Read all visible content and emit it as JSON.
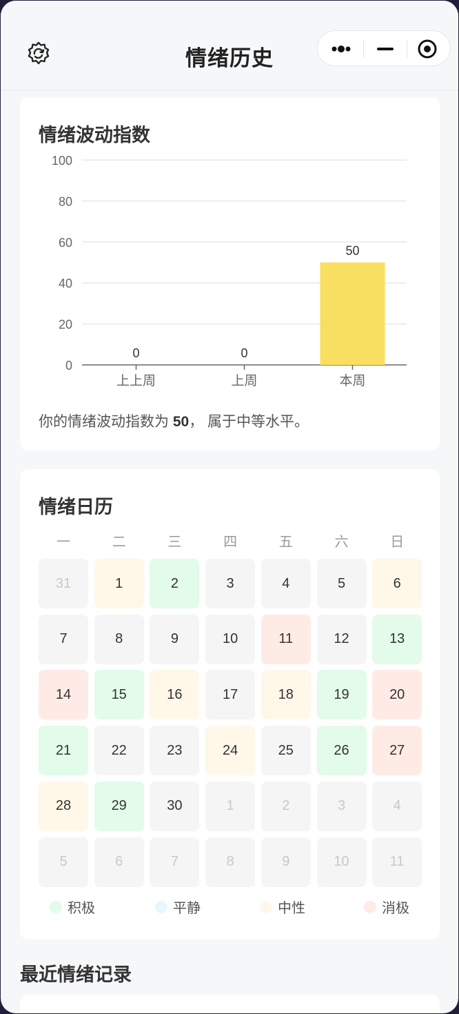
{
  "navbar": {
    "title": "情绪历史",
    "left_icon": "settings-gear-icon",
    "capsule": {
      "more_icon": "more-dots-icon",
      "minimize_icon": "minimize-icon",
      "close_icon": "target-close-icon"
    }
  },
  "fluctuation": {
    "title": "情绪波动指数",
    "summary_prefix": "你的情绪波动指数为 ",
    "summary_value": "50",
    "summary_suffix": "， 属于中等水平。"
  },
  "chart_data": {
    "type": "bar",
    "categories": [
      "上上周",
      "上周",
      "本周"
    ],
    "values": [
      0,
      0,
      50
    ],
    "data_labels": [
      "0",
      "0",
      "50"
    ],
    "ylim": [
      0,
      100
    ],
    "yticks": [
      0,
      20,
      40,
      60,
      80,
      100
    ],
    "grid": true,
    "bar_color": "#f8df5f"
  },
  "calendar": {
    "title": "情绪日历",
    "weekdays": [
      "一",
      "二",
      "三",
      "四",
      "五",
      "六",
      "日"
    ],
    "days": [
      {
        "n": "31",
        "mood": "none",
        "other": true
      },
      {
        "n": "1",
        "mood": "neutral",
        "other": false
      },
      {
        "n": "2",
        "mood": "positive",
        "other": false
      },
      {
        "n": "3",
        "mood": "none",
        "other": false
      },
      {
        "n": "4",
        "mood": "none",
        "other": false
      },
      {
        "n": "5",
        "mood": "none",
        "other": false
      },
      {
        "n": "6",
        "mood": "neutral",
        "other": false
      },
      {
        "n": "7",
        "mood": "none",
        "other": false
      },
      {
        "n": "8",
        "mood": "none",
        "other": false
      },
      {
        "n": "9",
        "mood": "none",
        "other": false
      },
      {
        "n": "10",
        "mood": "none",
        "other": false
      },
      {
        "n": "11",
        "mood": "negative",
        "other": false
      },
      {
        "n": "12",
        "mood": "none",
        "other": false
      },
      {
        "n": "13",
        "mood": "positive",
        "other": false
      },
      {
        "n": "14",
        "mood": "negative",
        "other": false
      },
      {
        "n": "15",
        "mood": "positive",
        "other": false
      },
      {
        "n": "16",
        "mood": "neutral",
        "other": false
      },
      {
        "n": "17",
        "mood": "none",
        "other": false
      },
      {
        "n": "18",
        "mood": "neutral",
        "other": false
      },
      {
        "n": "19",
        "mood": "positive",
        "other": false
      },
      {
        "n": "20",
        "mood": "negative",
        "other": false
      },
      {
        "n": "21",
        "mood": "positive",
        "other": false
      },
      {
        "n": "22",
        "mood": "none",
        "other": false
      },
      {
        "n": "23",
        "mood": "none",
        "other": false
      },
      {
        "n": "24",
        "mood": "neutral",
        "other": false
      },
      {
        "n": "25",
        "mood": "none",
        "other": false
      },
      {
        "n": "26",
        "mood": "positive",
        "other": false
      },
      {
        "n": "27",
        "mood": "negative",
        "other": false
      },
      {
        "n": "28",
        "mood": "neutral",
        "other": false
      },
      {
        "n": "29",
        "mood": "positive",
        "other": false
      },
      {
        "n": "30",
        "mood": "none",
        "other": false
      },
      {
        "n": "1",
        "mood": "none",
        "other": true
      },
      {
        "n": "2",
        "mood": "none",
        "other": true
      },
      {
        "n": "3",
        "mood": "none",
        "other": true
      },
      {
        "n": "4",
        "mood": "none",
        "other": true
      },
      {
        "n": "5",
        "mood": "none",
        "other": true
      },
      {
        "n": "6",
        "mood": "none",
        "other": true
      },
      {
        "n": "7",
        "mood": "none",
        "other": true
      },
      {
        "n": "8",
        "mood": "none",
        "other": true
      },
      {
        "n": "9",
        "mood": "none",
        "other": true
      },
      {
        "n": "10",
        "mood": "none",
        "other": true
      },
      {
        "n": "11",
        "mood": "none",
        "other": true
      }
    ],
    "legend": [
      {
        "label": "积极",
        "color": "#e3fbe9"
      },
      {
        "label": "平静",
        "color": "#e6f7ff"
      },
      {
        "label": "中性",
        "color": "#fff7e8"
      },
      {
        "label": "消极",
        "color": "#ffebe6"
      }
    ]
  },
  "recent": {
    "title": "最近情绪记录"
  }
}
